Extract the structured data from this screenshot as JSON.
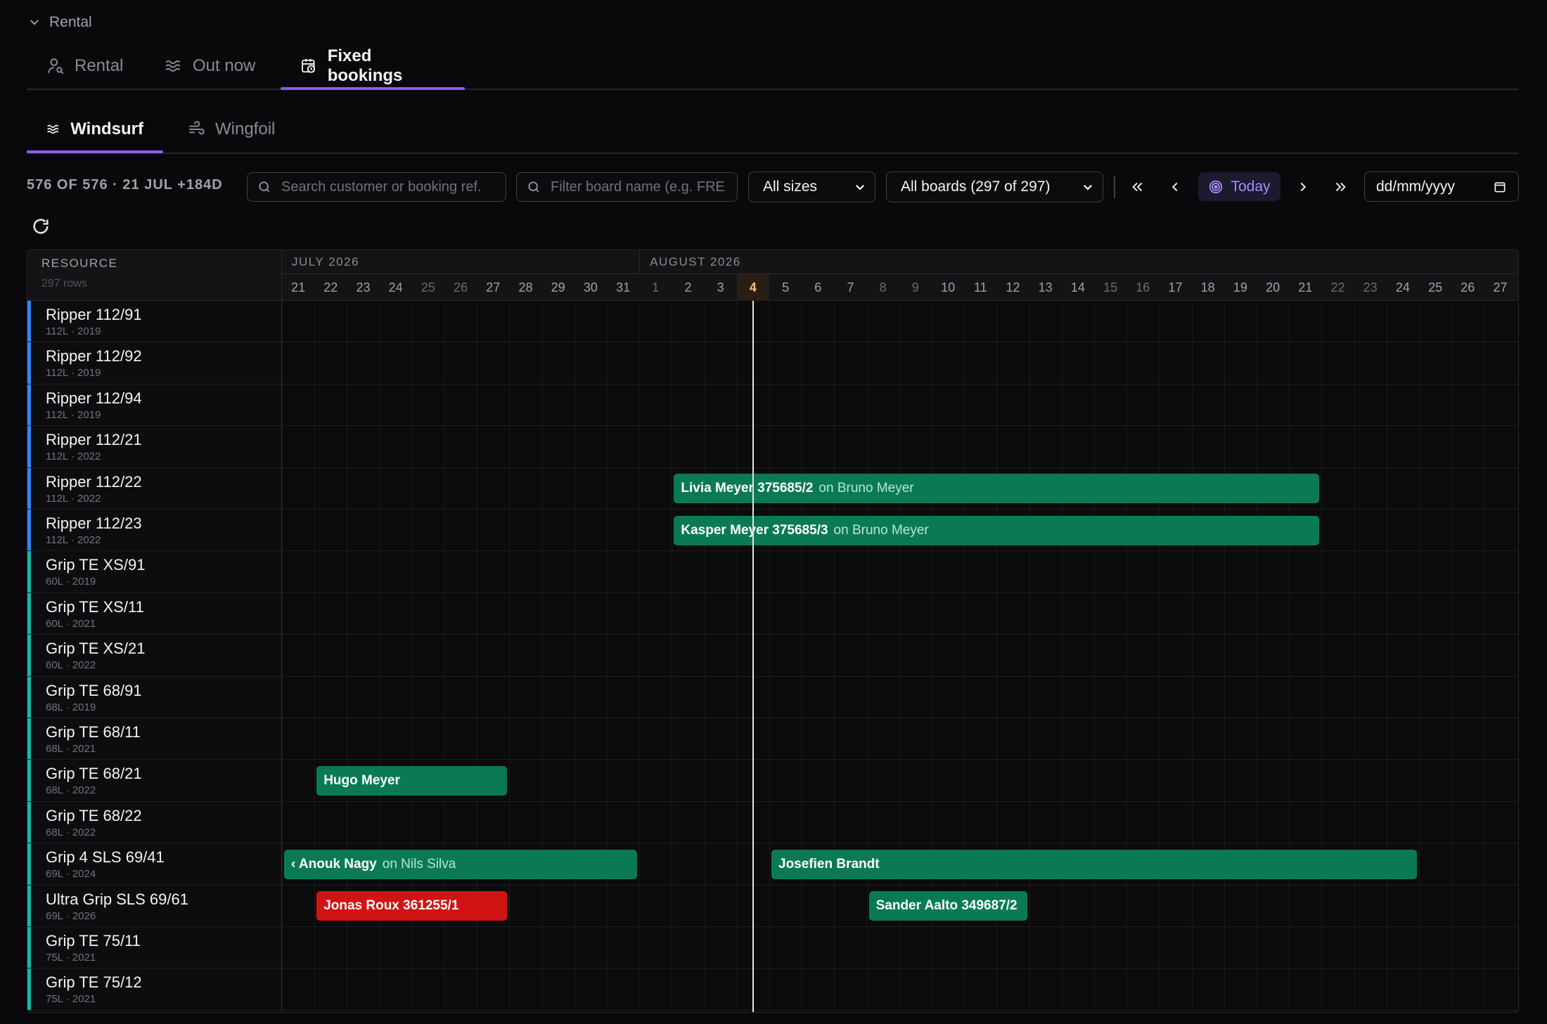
{
  "section": {
    "label": "Rental"
  },
  "tabs": [
    {
      "label": "Rental",
      "icon": "user-search-icon"
    },
    {
      "label": "Out now",
      "icon": "waves-icon"
    },
    {
      "label": "Fixed bookings",
      "icon": "calendar-clock-icon",
      "active": true
    }
  ],
  "subtabs": [
    {
      "label": "Windsurf",
      "icon": "waves-icon",
      "active": true
    },
    {
      "label": "Wingfoil",
      "icon": "wind-icon"
    }
  ],
  "toolbar": {
    "count": "576 OF 576 · 21 JUL +184D",
    "search_placeholder": "Search customer or booking ref.",
    "filter_placeholder": "Filter board name (e.g. FRE",
    "size_select": "All sizes",
    "board_select": "All boards (297 of 297)",
    "today_label": "Today",
    "date_placeholder": "dd/mm/yyyy"
  },
  "colors": {
    "accent": "#8b5cf6",
    "booking_green": "#0a7a55",
    "booking_red": "#d01414",
    "today_text": "#a78bfa"
  },
  "grid": {
    "resource_header": "RESOURCE",
    "row_count": "297 rows",
    "months": [
      {
        "label": "JULY 2026"
      },
      {
        "label": "AUGUST 2026"
      }
    ],
    "days": [
      {
        "d": "21",
        "we": false
      },
      {
        "d": "22",
        "we": false
      },
      {
        "d": "23",
        "we": false
      },
      {
        "d": "24",
        "we": false
      },
      {
        "d": "25",
        "we": true
      },
      {
        "d": "26",
        "we": true
      },
      {
        "d": "27",
        "we": false
      },
      {
        "d": "28",
        "we": false
      },
      {
        "d": "29",
        "we": false
      },
      {
        "d": "30",
        "we": false
      },
      {
        "d": "31",
        "we": false
      },
      {
        "d": "1",
        "we": true
      },
      {
        "d": "2",
        "we": false
      },
      {
        "d": "3",
        "we": false
      },
      {
        "d": "4",
        "we": false,
        "today": true
      },
      {
        "d": "5",
        "we": false
      },
      {
        "d": "6",
        "we": false
      },
      {
        "d": "7",
        "we": false
      },
      {
        "d": "8",
        "we": true
      },
      {
        "d": "9",
        "we": true
      },
      {
        "d": "10",
        "we": false
      },
      {
        "d": "11",
        "we": false
      },
      {
        "d": "12",
        "we": false
      },
      {
        "d": "13",
        "we": false
      },
      {
        "d": "14",
        "we": false
      },
      {
        "d": "15",
        "we": true
      },
      {
        "d": "16",
        "we": true
      },
      {
        "d": "17",
        "we": false
      },
      {
        "d": "18",
        "we": false
      },
      {
        "d": "19",
        "we": false
      },
      {
        "d": "20",
        "we": false
      },
      {
        "d": "21",
        "we": false
      },
      {
        "d": "22",
        "we": true
      },
      {
        "d": "23",
        "we": true
      },
      {
        "d": "24",
        "we": false
      },
      {
        "d": "25",
        "we": false
      },
      {
        "d": "26",
        "we": false
      },
      {
        "d": "27",
        "we": false
      }
    ],
    "rows": [
      {
        "name": "Ripper 112/91",
        "meta": "112L · 2019",
        "color": "#3b82f6"
      },
      {
        "name": "Ripper 112/92",
        "meta": "112L · 2019",
        "color": "#3b82f6"
      },
      {
        "name": "Ripper 112/94",
        "meta": "112L · 2019",
        "color": "#3b82f6"
      },
      {
        "name": "Ripper 112/21",
        "meta": "112L · 2022",
        "color": "#3b82f6"
      },
      {
        "name": "Ripper 112/22",
        "meta": "112L · 2022",
        "color": "#3b82f6"
      },
      {
        "name": "Ripper 112/23",
        "meta": "112L · 2022",
        "color": "#3b82f6"
      },
      {
        "name": "Grip TE XS/91",
        "meta": "60L · 2019",
        "color": "#14b8a6"
      },
      {
        "name": "Grip TE XS/11",
        "meta": "60L · 2021",
        "color": "#14b8a6"
      },
      {
        "name": "Grip TE XS/21",
        "meta": "60L · 2022",
        "color": "#14b8a6"
      },
      {
        "name": "Grip TE 68/91",
        "meta": "68L · 2019",
        "color": "#14b8a6"
      },
      {
        "name": "Grip TE 68/11",
        "meta": "68L · 2021",
        "color": "#14b8a6"
      },
      {
        "name": "Grip TE 68/21",
        "meta": "68L · 2022",
        "color": "#14b8a6"
      },
      {
        "name": "Grip TE 68/22",
        "meta": "68L · 2022",
        "color": "#14b8a6"
      },
      {
        "name": "Grip 4 SLS 69/41",
        "meta": "69L · 2024",
        "color": "#14b8a6"
      },
      {
        "name": "Ultra Grip SLS 69/61",
        "meta": "69L · 2026",
        "color": "#14b8a6"
      },
      {
        "name": "Grip TE 75/11",
        "meta": "75L · 2021",
        "color": "#14b8a6"
      },
      {
        "name": "Grip TE 75/12",
        "meta": "75L · 2021",
        "color": "#14b8a6"
      }
    ],
    "bookings": [
      {
        "row": 4,
        "start": 12,
        "end": 32,
        "label": "Livia Meyer 375685/2",
        "on": "on Bruno Meyer",
        "color": "green"
      },
      {
        "row": 5,
        "start": 12,
        "end": 32,
        "label": "Kasper Meyer 375685/3",
        "on": "on Bruno Meyer",
        "color": "green"
      },
      {
        "row": 11,
        "start": 1,
        "end": 7,
        "label": "Hugo Meyer",
        "on": "",
        "color": "green"
      },
      {
        "row": 13,
        "start": 0,
        "end": 11,
        "label": "‹ Anouk Nagy",
        "on": "on Nils Silva",
        "color": "green"
      },
      {
        "row": 13,
        "start": 15,
        "end": 35,
        "label": "Josefien Brandt",
        "on": "",
        "color": "green"
      },
      {
        "row": 14,
        "start": 1,
        "end": 7,
        "label": "Jonas Roux 361255/1",
        "on": "",
        "color": "red"
      },
      {
        "row": 14,
        "start": 18,
        "end": 23,
        "label": "Sander Aalto 349687/2",
        "on": "",
        "color": "green"
      }
    ]
  }
}
